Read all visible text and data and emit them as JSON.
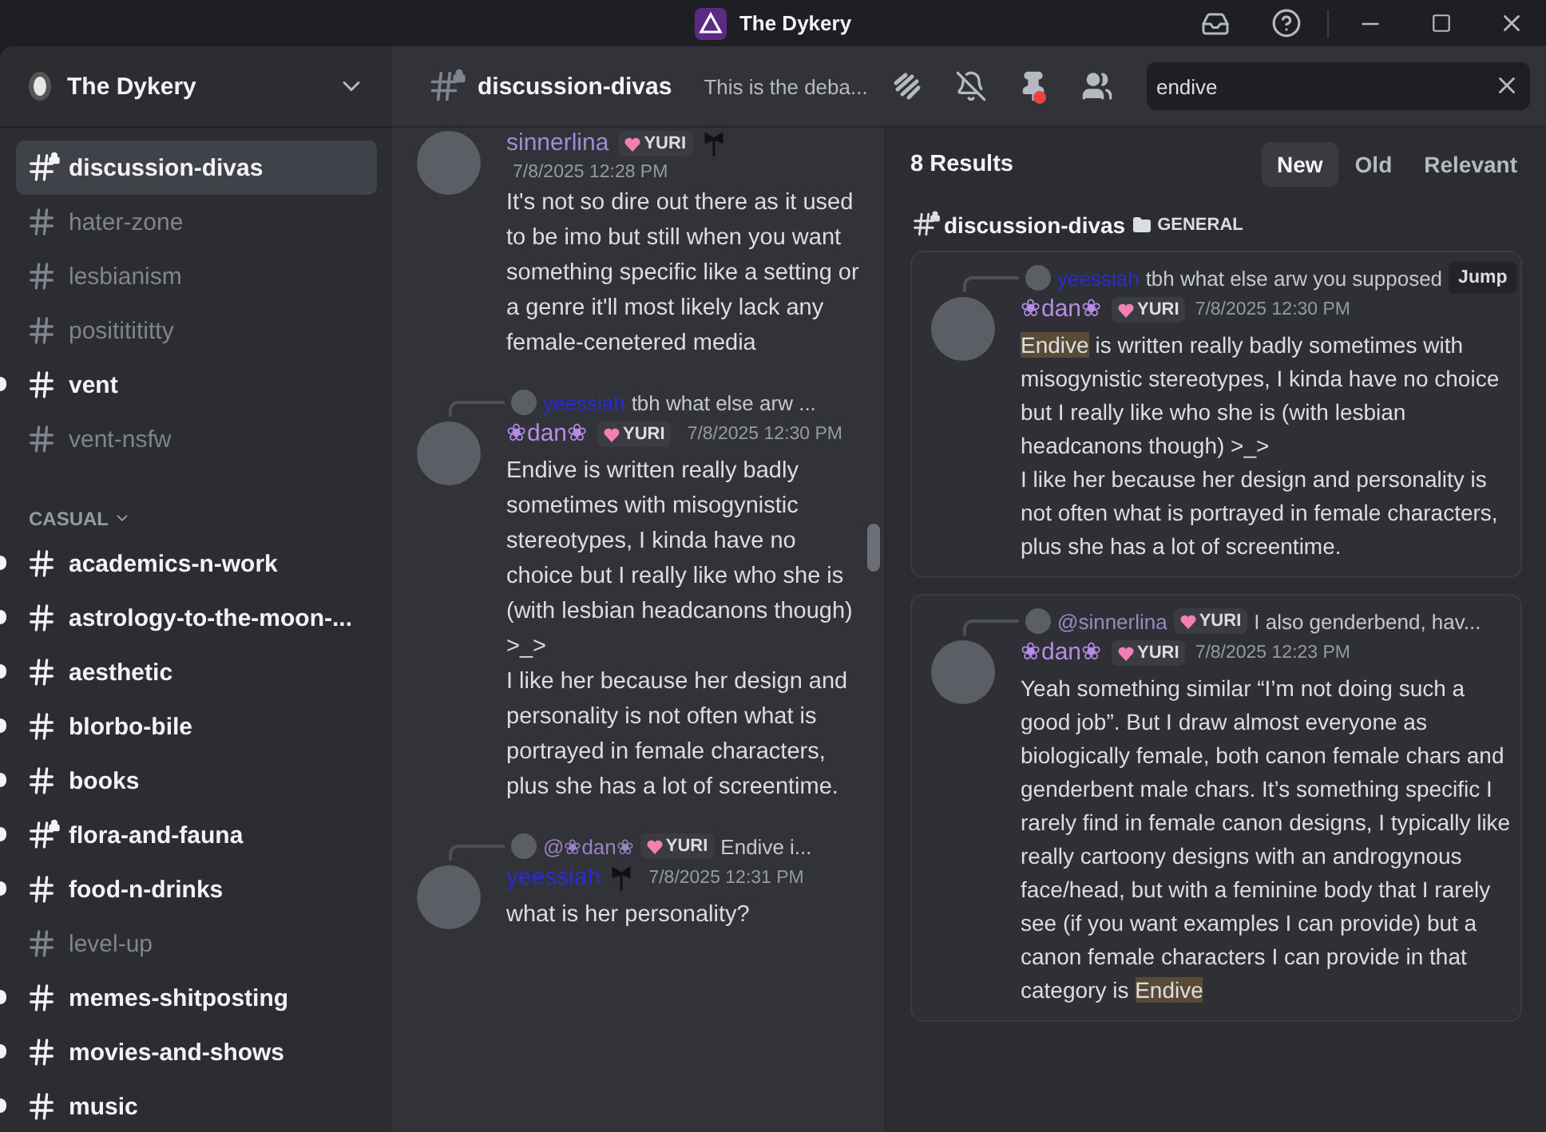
{
  "app_title": "The Dykery",
  "server": {
    "name": "The Dykery"
  },
  "sidebar": {
    "channels": [
      {
        "name": "discussion-divas",
        "selected": true,
        "unread": false,
        "locked": true
      },
      {
        "name": "hater-zone",
        "selected": false,
        "unread": false,
        "locked": false
      },
      {
        "name": "lesbianism",
        "selected": false,
        "unread": false,
        "locked": false
      },
      {
        "name": "posititititty",
        "selected": false,
        "unread": false,
        "locked": false
      },
      {
        "name": "vent",
        "selected": false,
        "unread": true,
        "locked": false
      },
      {
        "name": "vent-nsfw",
        "selected": false,
        "unread": false,
        "locked": false
      }
    ],
    "categories": [
      {
        "name": "CASUAL",
        "expanded": true,
        "channels": [
          {
            "name": "academics-n-work",
            "selected": false,
            "unread": true,
            "locked": false
          },
          {
            "name": "astrology-to-the-moon-...",
            "selected": false,
            "unread": true,
            "locked": false
          },
          {
            "name": "aesthetic",
            "selected": false,
            "unread": true,
            "locked": false
          },
          {
            "name": "blorbo-bile",
            "selected": false,
            "unread": true,
            "locked": false
          },
          {
            "name": "books",
            "selected": false,
            "unread": true,
            "locked": false
          },
          {
            "name": "flora-and-fauna",
            "selected": false,
            "unread": true,
            "locked": true
          },
          {
            "name": "food-n-drinks",
            "selected": false,
            "unread": true,
            "locked": false
          },
          {
            "name": "level-up",
            "selected": false,
            "unread": false,
            "locked": false
          },
          {
            "name": "memes-shitposting",
            "selected": false,
            "unread": true,
            "locked": false
          },
          {
            "name": "movies-and-shows",
            "selected": false,
            "unread": true,
            "locked": false
          },
          {
            "name": "music",
            "selected": false,
            "unread": true,
            "locked": false
          }
        ]
      }
    ]
  },
  "header": {
    "channel": "discussion-divas",
    "locked": true,
    "topic": "This is the deba...",
    "pins_unread": true
  },
  "search": {
    "value": "endive"
  },
  "messages": [
    {
      "author": {
        "name": "sinnerlina",
        "color": "#a18bd3"
      },
      "badge": "YURI",
      "decoration": true,
      "timestamp": "7/8/2025 12:28 PM",
      "body": [
        {
          "text": "It's not so dire out there as it used to be imo but still when you want something specific like a setting or a genre it'll most likely lack any female-cenetered media",
          "highlight": false
        }
      ]
    },
    {
      "reply": {
        "name": "yeessiah",
        "color": "#2a2ad8",
        "text": "tbh what else arw ..."
      },
      "author": {
        "name": "❀dan❀",
        "color": "#b58ce6"
      },
      "badge": "YURI",
      "decoration": false,
      "timestamp": "7/8/2025 12:30 PM",
      "body": [
        {
          "text": "Endive is written really badly sometimes with misogynistic stereotypes, I kinda have no choice but I really like who she is (with lesbian headcanons though) >_>\nI like her because her design and personality is not often what is portrayed in female characters, plus she has a lot of screentime.",
          "highlight": false
        }
      ]
    },
    {
      "reply": {
        "name": "@❀dan❀",
        "color": "#9a80c4",
        "badge": "YURI",
        "text": "Endive i..."
      },
      "author": {
        "name": "yeessiah",
        "color": "#2a2ad8"
      },
      "decoration": true,
      "timestamp": "7/8/2025 12:31 PM",
      "body": [
        {
          "text": "what is her personality?",
          "highlight": false
        }
      ]
    }
  ],
  "results": {
    "count": "8 Results",
    "sort": [
      {
        "label": "New",
        "selected": true
      },
      {
        "label": "Old",
        "selected": false
      },
      {
        "label": "Relevant",
        "selected": false
      }
    ],
    "channel": "discussion-divas",
    "category": "GENERAL",
    "items": [
      {
        "reply": {
          "name": "yeessiah",
          "color": "#2a2ad8",
          "text": "tbh what else arw you supposed"
        },
        "jump": "Jump",
        "author": {
          "name": "❀dan❀",
          "color": "#b58ce6"
        },
        "badge": "YURI",
        "timestamp": "7/8/2025 12:30 PM",
        "body": [
          {
            "text": "Endive",
            "highlight": true
          },
          {
            "text": " is written really badly sometimes with misogynistic stereotypes, I kinda have no choice but I really like who she is (with lesbian headcanons though) >_>\nI like her because her design and personality is not often what is portrayed in female characters, plus she has a lot of screentime.",
            "highlight": false
          }
        ]
      },
      {
        "reply": {
          "name": "@sinnerlina",
          "color": "#9a88c0",
          "badge": "YURI",
          "text": "I also genderbend, hav..."
        },
        "author": {
          "name": "❀dan❀",
          "color": "#b58ce6"
        },
        "badge": "YURI",
        "timestamp": "7/8/2025 12:23 PM",
        "body": [
          {
            "text": "Yeah something similar “I’m not doing such a good job”. But I draw almost everyone as biologically female, both canon female chars and genderbent male chars. It’s something specific I rarely find in female canon designs, I typically like really cartoony designs with an androgynous face/head, but with a feminine body that I rarely see (if you want examples I can provide) but a canon female characters I can provide in that category is ",
            "highlight": false
          },
          {
            "text": "Endive",
            "highlight": true
          }
        ]
      }
    ]
  }
}
